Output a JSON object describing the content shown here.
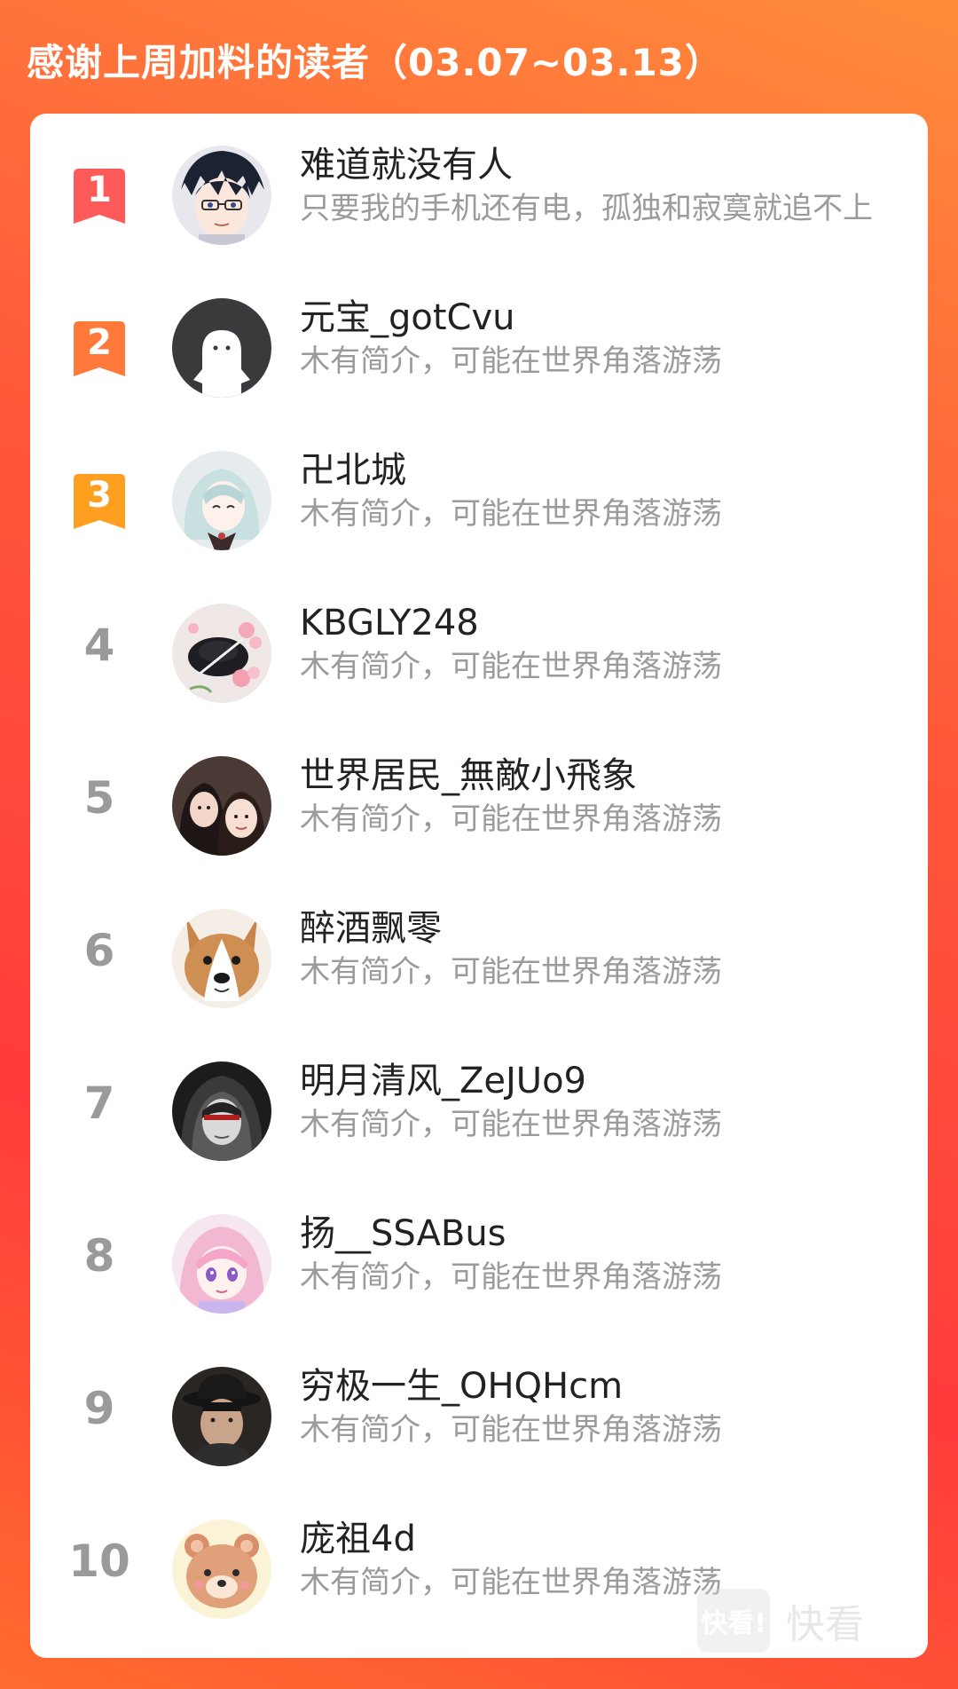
{
  "header": {
    "title": "感谢上周加料的读者（03.07~03.13）"
  },
  "colors": {
    "rank1": "#ff5a5a",
    "rank2": "#ff7a3a",
    "rank3": "#ff9f1f",
    "rank_plain": "#9a9a9a"
  },
  "readers": [
    {
      "rank": "1",
      "name": "难道就没有人",
      "bio": "只要我的手机还有电，孤独和寂寞就追不上",
      "avatar_icon": "anime-boy-avatar"
    },
    {
      "rank": "2",
      "name": "元宝_gotCvu",
      "bio": "木有简介，可能在世界角落游荡",
      "avatar_icon": "default-ghost-avatar"
    },
    {
      "rank": "3",
      "name": "卍北城",
      "bio": "木有简介，可能在世界角落游荡",
      "avatar_icon": "anime-girl-avatar"
    },
    {
      "rank": "4",
      "name": "KBGLY248",
      "bio": "木有简介，可能在世界角落游荡",
      "avatar_icon": "flowers-hat-avatar"
    },
    {
      "rank": "5",
      "name": "世界居民_無敵小飛象",
      "bio": "木有简介，可能在世界角落游荡",
      "avatar_icon": "two-girls-avatar"
    },
    {
      "rank": "6",
      "name": "醉酒飘零",
      "bio": "木有简介，可能在世界角落游荡",
      "avatar_icon": "corgi-dog-avatar"
    },
    {
      "rank": "7",
      "name": "明月清风_ZeJUo9",
      "bio": "木有简介，可能在世界角落游荡",
      "avatar_icon": "hooded-figure-avatar"
    },
    {
      "rank": "8",
      "name": "扬__SSABus",
      "bio": "木有简介，可能在世界角落游荡",
      "avatar_icon": "pink-anime-avatar"
    },
    {
      "rank": "9",
      "name": "穷极一生_OHQHcm",
      "bio": "木有简介，可能在世界角落游荡",
      "avatar_icon": "man-fedora-avatar"
    },
    {
      "rank": "10",
      "name": "庞祖4d",
      "bio": "木有简介，可能在世界角落游荡",
      "avatar_icon": "bear-cartoon-avatar"
    }
  ],
  "watermark": {
    "logo_text": "快看!",
    "text": "快看"
  }
}
